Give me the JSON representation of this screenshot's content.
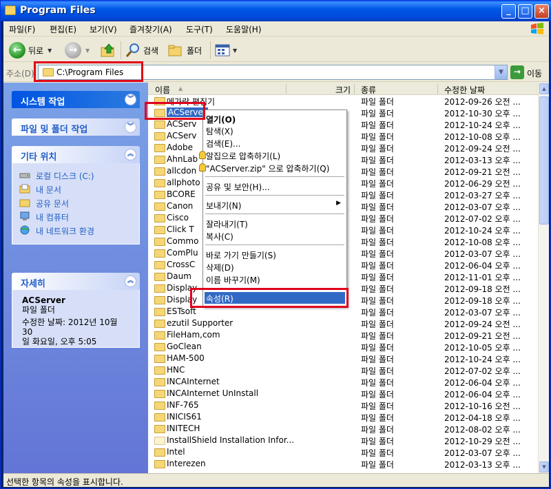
{
  "window": {
    "title": "Program Files"
  },
  "menubar": [
    "파일(F)",
    "편집(E)",
    "보기(V)",
    "즐겨찾기(A)",
    "도구(T)",
    "도움말(H)"
  ],
  "toolbar": {
    "back": "뒤로",
    "search": "검색",
    "folders": "폴더"
  },
  "address": {
    "label": "주소(D)",
    "path": "C:\\Program Files",
    "go": "이동"
  },
  "tasks": {
    "system": "시스템 작업",
    "file_folder": "파일 및 폴더 작업",
    "other_places": {
      "title": "기타 위치",
      "items": [
        "로컬 디스크 (C:)",
        "내 문서",
        "공유 문서",
        "내 컴퓨터",
        "내 네트워크 환경"
      ]
    },
    "details": {
      "title": "자세히",
      "name": "ACServer",
      "type": "파일 폴더",
      "modified_line1": "수정한 날짜: 2012년 10월 30",
      "modified_line2": "일 화요일, 오후 5:05"
    }
  },
  "columns": {
    "name": "이름",
    "size": "크기",
    "type": "종류",
    "date": "수정한 날짜"
  },
  "files": [
    {
      "name": "메가락 편집기",
      "type": "파일 폴더",
      "date": "2012-09-26 오전 ..."
    },
    {
      "name": "ACServer",
      "type": "파일 폴더",
      "date": "2012-10-30 오후 ..."
    },
    {
      "name": "ACServ",
      "type": "파일 폴더",
      "date": "2012-10-24 오후 ..."
    },
    {
      "name": "ACServ",
      "type": "파일 폴더",
      "date": "2012-10-08 오후 ..."
    },
    {
      "name": "Adobe",
      "type": "파일 폴더",
      "date": "2012-09-24 오전 ..."
    },
    {
      "name": "AhnLab",
      "type": "파일 폴더",
      "date": "2012-03-13 오후 ..."
    },
    {
      "name": "allcdon",
      "type": "파일 폴더",
      "date": "2012-09-21 오전 ..."
    },
    {
      "name": "allphoto",
      "type": "파일 폴더",
      "date": "2012-06-29 오전 ..."
    },
    {
      "name": "BCORE",
      "type": "파일 폴더",
      "date": "2012-03-27 오후 ..."
    },
    {
      "name": "Canon",
      "type": "파일 폴더",
      "date": "2012-03-07 오후 ..."
    },
    {
      "name": "Cisco",
      "type": "파일 폴더",
      "date": "2012-07-02 오후 ..."
    },
    {
      "name": "Click T",
      "type": "파일 폴더",
      "date": "2012-10-24 오후 ..."
    },
    {
      "name": "Commo",
      "type": "파일 폴더",
      "date": "2012-10-08 오후 ..."
    },
    {
      "name": "ComPlu",
      "type": "파일 폴더",
      "date": "2012-03-07 오후 ..."
    },
    {
      "name": "CrossC",
      "type": "파일 폴더",
      "date": "2012-06-04 오후 ..."
    },
    {
      "name": "Daum",
      "type": "파일 폴더",
      "date": "2012-11-01 오후 ..."
    },
    {
      "name": "Display",
      "type": "파일 폴더",
      "date": "2012-09-18 오전 ..."
    },
    {
      "name": "Display",
      "type": "파일 폴더",
      "date": "2012-09-18 오후 ..."
    },
    {
      "name": "ESTsoft",
      "type": "파일 폴더",
      "date": "2012-03-07 오후 ..."
    },
    {
      "name": "ezutil Supporter",
      "type": "파일 폴더",
      "date": "2012-09-24 오전 ..."
    },
    {
      "name": "FileHam,com",
      "type": "파일 폴더",
      "date": "2012-09-21 오전 ..."
    },
    {
      "name": "GoClean",
      "type": "파일 폴더",
      "date": "2012-10-05 오후 ..."
    },
    {
      "name": "HAM-500",
      "type": "파일 폴더",
      "date": "2012-10-24 오후 ..."
    },
    {
      "name": "HNC",
      "type": "파일 폴더",
      "date": "2012-07-02 오후 ..."
    },
    {
      "name": "INCAInternet",
      "type": "파일 폴더",
      "date": "2012-06-04 오후 ..."
    },
    {
      "name": "INCAInternet UnInstall",
      "type": "파일 폴더",
      "date": "2012-06-04 오후 ..."
    },
    {
      "name": "INF-765",
      "type": "파일 폴더",
      "date": "2012-10-16 오전 ..."
    },
    {
      "name": "INICIS61",
      "type": "파일 폴더",
      "date": "2012-04-18 오후 ..."
    },
    {
      "name": "INITECH",
      "type": "파일 폴더",
      "date": "2012-08-02 오후 ..."
    },
    {
      "name": "InstallShield Installation Infor...",
      "type": "파일 폴더",
      "date": "2012-10-29 오전 ..."
    },
    {
      "name": "Intel",
      "type": "파일 폴더",
      "date": "2012-03-07 오후 ..."
    },
    {
      "name": "Interezen",
      "type": "파일 폴더",
      "date": "2012-03-13 오후 ..."
    }
  ],
  "context_menu": {
    "open": "열기(O)",
    "explore": "탐색(X)",
    "search": "검색(E)...",
    "zip": "알집으로 압축하기(L)",
    "zip_named": "\"ACServer.zip\" 으로 압축하기(Q)",
    "share": "공유 및 보안(H)...",
    "send_to": "보내기(N)",
    "cut": "잘라내기(T)",
    "copy": "복사(C)",
    "shortcut": "바로 가기 만들기(S)",
    "delete": "삭제(D)",
    "rename": "이름 바꾸기(M)",
    "properties": "속성(R)"
  },
  "status": "선택한 항목의 속성을 표시합니다."
}
